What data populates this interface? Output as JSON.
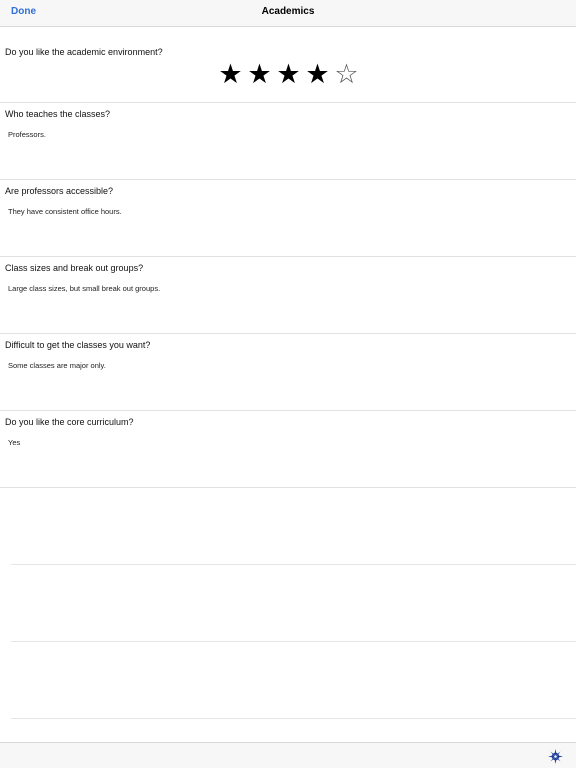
{
  "navbar": {
    "done_label": "Done",
    "title": "Academics"
  },
  "rating": {
    "question": "Do you like the academic environment?",
    "value": 4,
    "max": 5
  },
  "questions": [
    {
      "question": "Who teaches the classes?",
      "answer": "Professors."
    },
    {
      "question": "Are professors accessible?",
      "answer": "They have consistent office hours."
    },
    {
      "question": "Class sizes and break out groups?",
      "answer": "Large class sizes, but small break out groups."
    },
    {
      "question": "Difficult to get the classes you want?",
      "answer": "Some classes are major only."
    },
    {
      "question": "Do you like the core curriculum?",
      "answer": "Yes"
    }
  ],
  "toolbar": {
    "icon": "compass-icon",
    "accent_color": "#1f3f9a"
  },
  "colors": {
    "link": "#2f6fd6"
  }
}
